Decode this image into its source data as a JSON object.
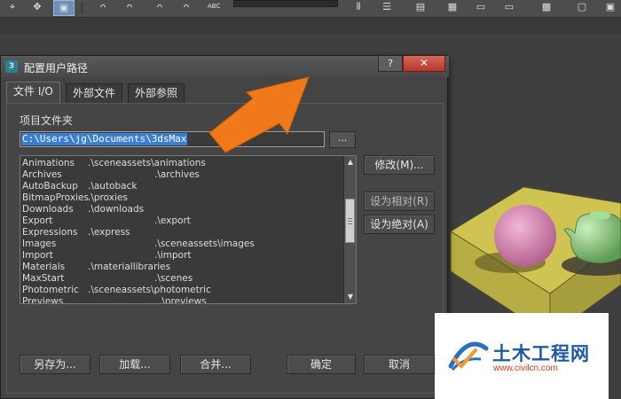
{
  "toolbar": {
    "abc_label": "ABC",
    "colors": {
      "bg": "#4d4d4d",
      "active": "#6f8fb6"
    }
  },
  "dialog": {
    "title": "配置用户路径",
    "help_label": "?",
    "close_label": "✕",
    "tabs": [
      {
        "label": "文件 I/O",
        "active": true
      },
      {
        "label": "外部文件",
        "active": false
      },
      {
        "label": "外部参照",
        "active": false
      }
    ],
    "section_label": "项目文件夹",
    "project_path": "C:\\Users\\jg\\Documents\\3dsMax",
    "browse_label": "...",
    "paths": [
      {
        "name": "Animations",
        "path": ".\\sceneassets\\animations"
      },
      {
        "name": "Archives",
        "path": ".\\archives"
      },
      {
        "name": "AutoBackup",
        "path": ".\\autoback"
      },
      {
        "name": "BitmapProxies",
        "path": ".\\proxies"
      },
      {
        "name": "Downloads",
        "path": ".\\downloads"
      },
      {
        "name": "Export",
        "path": ".\\export"
      },
      {
        "name": "Expressions",
        "path": ".\\express"
      },
      {
        "name": "Images",
        "path": ".\\sceneassets\\images"
      },
      {
        "name": "Import",
        "path": ".\\import"
      },
      {
        "name": "Materials",
        "path": ".\\materiallibraries"
      },
      {
        "name": "MaxStart",
        "path": ".\\scenes"
      },
      {
        "name": "Photometric",
        "path": ".\\sceneassets\\photometric"
      },
      {
        "name": "Previews",
        "path": ".\\previews"
      }
    ],
    "side_buttons": {
      "modify": "修改(M)...",
      "make_relative": "设为相对(R)",
      "make_absolute": "设为绝对(A)"
    },
    "footer_buttons": {
      "save_as": "另存为...",
      "load": "加载...",
      "merge": "合并...",
      "ok": "确定",
      "cancel": "取消"
    }
  },
  "watermark": {
    "title": "土木工程网",
    "url": "www.civilcn.com"
  },
  "colors": {
    "selection": "#3c7fd1",
    "close": "#c8463a",
    "arrow": "#f07a1a",
    "sphere": "#d77fb0",
    "teapot": "#8fd17f",
    "base": "#d9cf57"
  }
}
